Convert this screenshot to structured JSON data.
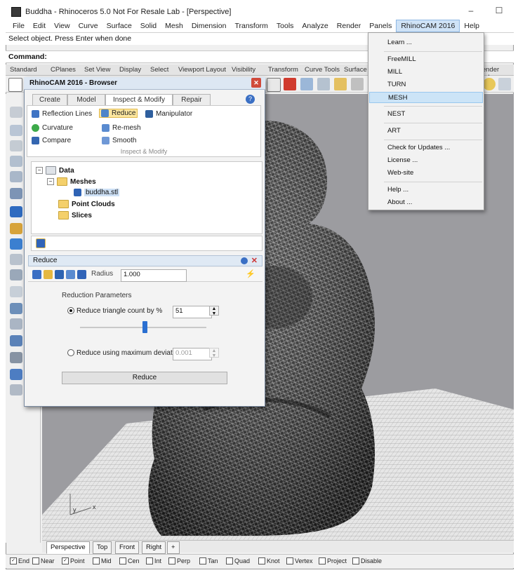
{
  "window": {
    "title": "Buddha - Rhinoceros 5.0 Not For Resale Lab - [Perspective]",
    "minimize": "–",
    "maximize": "☐"
  },
  "menubar": [
    "File",
    "Edit",
    "View",
    "Curve",
    "Surface",
    "Solid",
    "Mesh",
    "Dimension",
    "Transform",
    "Tools",
    "Analyze",
    "Render",
    "Panels",
    "RhinoCAM 2016",
    "Help"
  ],
  "command_history": "Select object. Press Enter when done",
  "command_prompt": "Command:",
  "toolbar_tabs": [
    "Standard",
    "CPlanes",
    "Set View",
    "Display",
    "Select",
    "Viewport Layout",
    "Visibility",
    "Transform",
    "Curve Tools",
    "Surface Tools",
    "Render Tools"
  ],
  "browser": {
    "title": "RhinoCAM 2016 - Browser",
    "tabs": [
      "Create",
      "Model",
      "Inspect & Modify",
      "Repair"
    ],
    "ribbon": {
      "reflection_lines": "Reflection Lines",
      "reduce": "Reduce",
      "manipulator": "Manipulator",
      "curvature": "Curvature",
      "remesh": "Re-mesh",
      "compare": "Compare",
      "smooth": "Smooth",
      "group": "Inspect & Modify"
    },
    "tree": {
      "data": "Data",
      "meshes": "Meshes",
      "mesh_item": "buddha.stl",
      "point_clouds": "Point Clouds",
      "slices": "Slices"
    }
  },
  "reduce": {
    "title": "Reduce",
    "radius_label": "Radius",
    "radius_value": "1.000",
    "params_title": "Reduction Parameters",
    "option1": "Reduce triangle count by %",
    "option1_value": "51",
    "slider_percent": 51,
    "option2": "Reduce using maximum deviation",
    "option2_value": "0.001",
    "button": "Reduce"
  },
  "rhinocam_menu": {
    "items": [
      "Learn ...",
      "FreeMILL",
      "MILL",
      "TURN",
      "MESH",
      "NEST",
      "ART",
      "Check for Updates ...",
      "License ...",
      "Web-site",
      "Help ...",
      "About ..."
    ],
    "highlighted": "MESH"
  },
  "view_tabs": [
    "Perspective",
    "Top",
    "Front",
    "Right"
  ],
  "view_add": "+",
  "osnaps": [
    "End",
    "Near",
    "Point",
    "Mid",
    "Cen",
    "Int",
    "Perp",
    "Tan",
    "Quad",
    "Knot",
    "Vertex",
    "Project",
    "Disable"
  ],
  "axis": {
    "x": "x",
    "y": "y"
  },
  "colors": {
    "accent": "#cce4f7",
    "selected_tool": "#fde7a0",
    "viewport_bg": "#9c9ca0"
  }
}
